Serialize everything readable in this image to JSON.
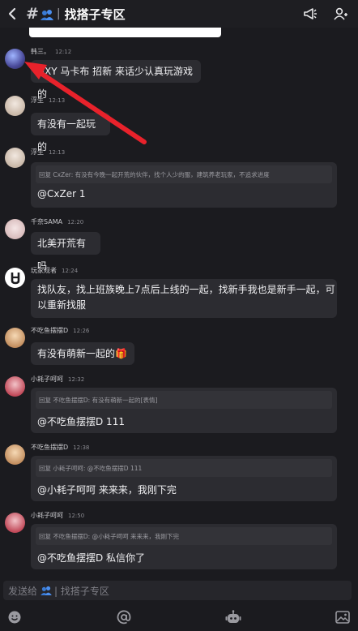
{
  "header": {
    "hash": "#",
    "separator": "|",
    "title": "找搭子专区",
    "icons": [
      "back-arrow-icon",
      "people-icon",
      "megaphone-icon",
      "add-user-icon"
    ]
  },
  "messages": [
    {
      "user": "韩三。",
      "time": "12:12",
      "text": "NXY 马卡布 招新 来话少认真玩游戏的",
      "avatar": "avatar-han"
    },
    {
      "user": "浮生",
      "time": "12:13",
      "text": "有没有一起玩的",
      "avatar": "avatar-fusheng"
    },
    {
      "user": "浮生",
      "time": "12:13",
      "quote": "回复 CxZer: 有没有今晚一起开荒的伙伴，找个人少的服，建筑养老玩家，不追求进度",
      "text": "@CxZer 1",
      "avatar": "avatar-fusheng"
    },
    {
      "user": "千奈SAMA",
      "time": "12:20",
      "text": "北美开荒有吗",
      "avatar": "avatar-qiannai"
    },
    {
      "user": "玩家观者",
      "time": "12:24",
      "text_line1": "找队友，找上班族晚上7点后上线的一起，找新手我也是新手一起，可",
      "text_line2": "以重新找服",
      "avatar": "avatar-guanzhe"
    },
    {
      "user": "不吃鱼摆摆D",
      "time": "12:26",
      "text": "有没有萌新一起的",
      "sticker": "🎁",
      "avatar": "avatar-buchiyu"
    },
    {
      "user": "小耗子呵呵",
      "time": "12:32",
      "quote": "回复 不吃鱼摆摆D: 有没有萌新一起的[表情]",
      "text": "@不吃鱼摆摆D 111",
      "avatar": "avatar-xiaohaozi"
    },
    {
      "user": "不吃鱼摆摆D",
      "time": "12:38",
      "quote": "回复 小耗子呵呵: @不吃鱼摆摆D 111",
      "text": "@小耗子呵呵 来来来，我刚下完",
      "avatar": "avatar-buchiyu"
    },
    {
      "user": "小耗子呵呵",
      "time": "12:50",
      "quote": "回复 不吃鱼摆摆D: @小耗子呵呵 来来来，我刚下完",
      "text": "@不吃鱼摆摆D 私信你了",
      "avatar": "avatar-xiaohaozi"
    }
  ],
  "composer": {
    "placeholder_prefix": "发送给",
    "placeholder_channel": "| 找搭子专区"
  },
  "bottom_icons": [
    "emoji-icon",
    "at-icon",
    "robot-icon",
    "image-icon"
  ],
  "colors": {
    "background": "#1b1b1f",
    "bubble": "#2c2c31",
    "accent_arrow": "#e8222b"
  }
}
